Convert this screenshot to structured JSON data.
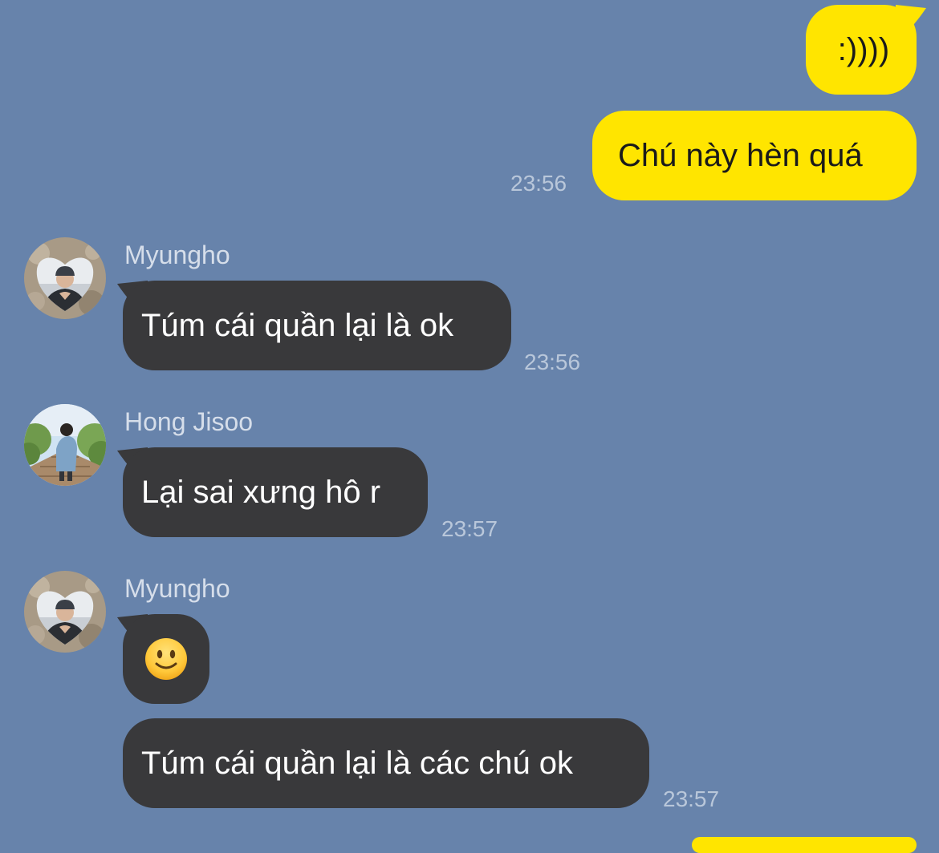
{
  "colors": {
    "background": "#6783ab",
    "outgoing_bubble": "#ffe500",
    "incoming_bubble": "#39393b",
    "timestamp": "#b9c7da",
    "sender_name": "#d6deea"
  },
  "messages": {
    "m1": {
      "text": ":))))"
    },
    "m2": {
      "text": "Chú này hèn quá",
      "time": "23:56"
    },
    "m3": {
      "sender": "Myungho",
      "text": "Túm cái quần lại là ok",
      "time": "23:56"
    },
    "m4": {
      "sender": "Hong Jisoo",
      "text": "Lại sai xưng hô r",
      "time": "23:57"
    },
    "m5": {
      "sender": "Myungho",
      "emoji": "slightly-smiling-face-icon"
    },
    "m6": {
      "text": "Túm cái quần lại là các chú ok",
      "time": "23:57"
    }
  },
  "avatars": {
    "myungho": "myungho-avatar",
    "hong_jisoo": "hong-jisoo-avatar"
  }
}
